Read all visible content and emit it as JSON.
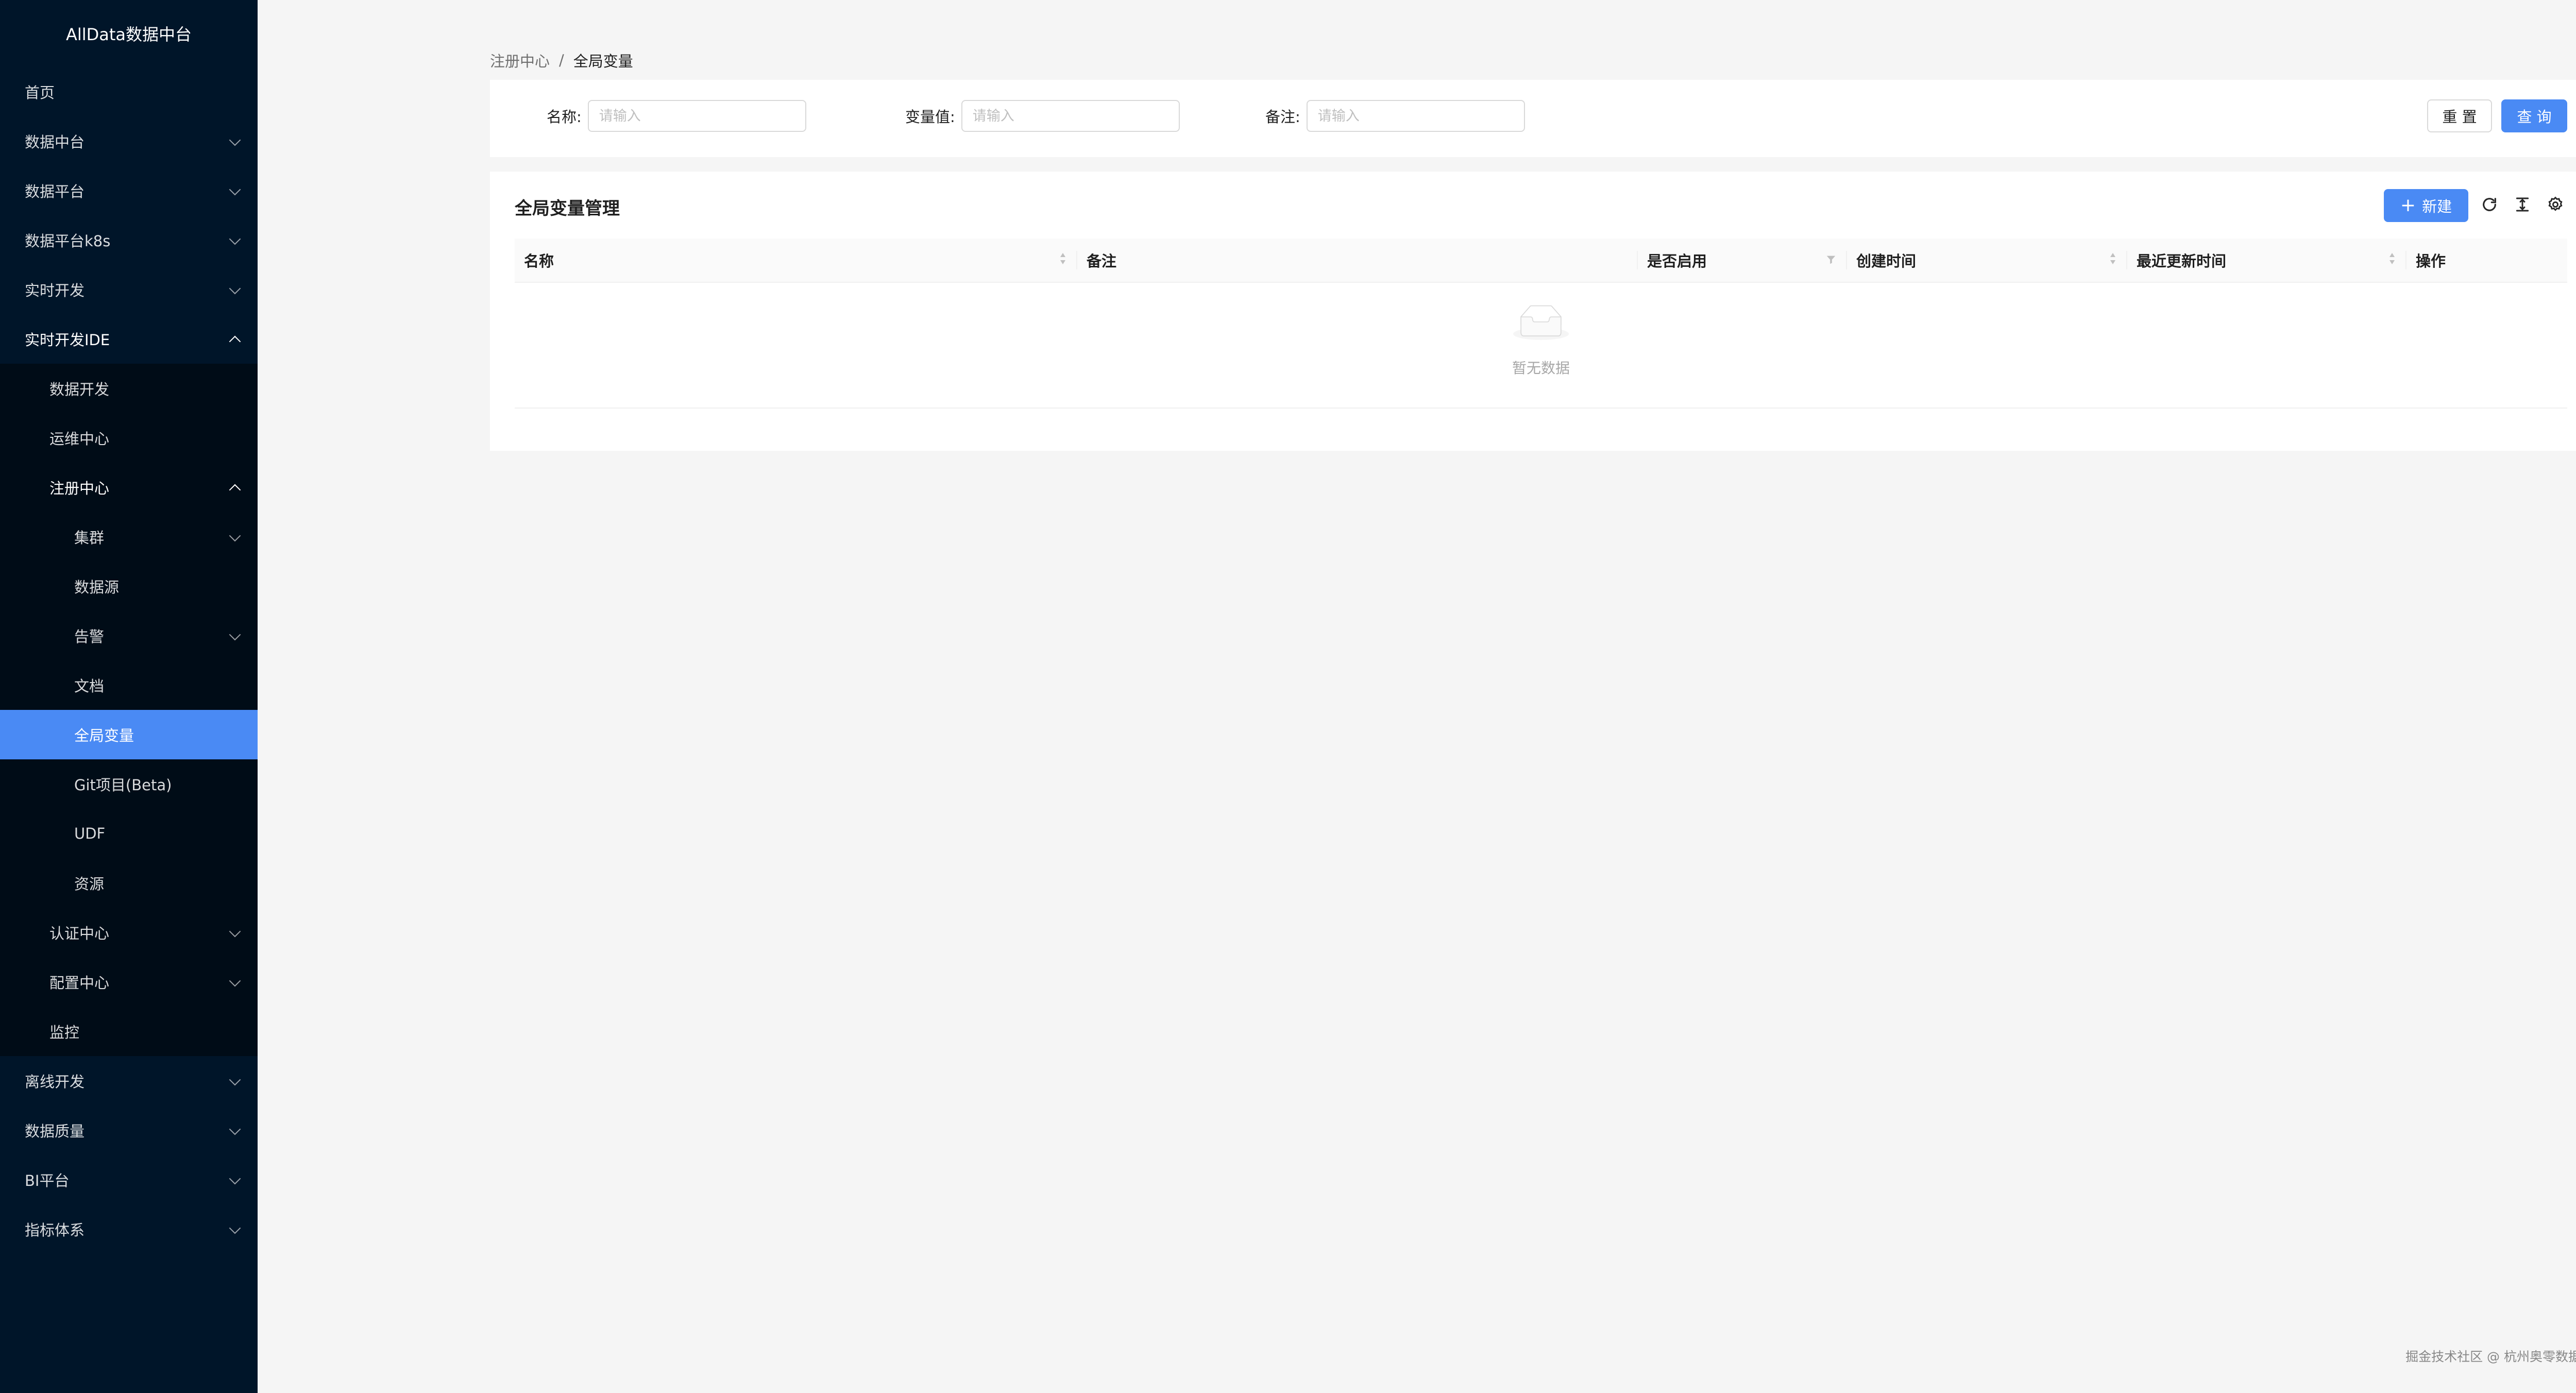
{
  "app": {
    "title": "AllData数据中台"
  },
  "sidebar": {
    "items": [
      {
        "label": "首页"
      },
      {
        "label": "数据中台"
      },
      {
        "label": "数据平台"
      },
      {
        "label": "数据平台k8s"
      },
      {
        "label": "实时开发"
      },
      {
        "label": "实时开发IDE"
      },
      {
        "label": "数据开发"
      },
      {
        "label": "运维中心"
      },
      {
        "label": "注册中心"
      },
      {
        "label": "集群"
      },
      {
        "label": "数据源"
      },
      {
        "label": "告警"
      },
      {
        "label": "文档"
      },
      {
        "label": "全局变量"
      },
      {
        "label": "Git项目(Beta)"
      },
      {
        "label": "UDF"
      },
      {
        "label": "资源"
      },
      {
        "label": "认证中心"
      },
      {
        "label": "配置中心"
      },
      {
        "label": "监控"
      },
      {
        "label": "离线开发"
      },
      {
        "label": "数据质量"
      },
      {
        "label": "BI平台"
      },
      {
        "label": "指标体系"
      }
    ]
  },
  "breadcrumb": {
    "parent": "注册中心",
    "separator": "/",
    "current": "全局变量"
  },
  "search": {
    "name_label": "名称:",
    "name_placeholder": "请输入",
    "value_label": "变量值:",
    "value_placeholder": "请输入",
    "note_label": "备注:",
    "note_placeholder": "请输入",
    "reset_label": "重 置",
    "query_label": "查 询"
  },
  "table": {
    "title": "全局变量管理",
    "new_label": "新建",
    "columns": [
      "名称",
      "备注",
      "是否启用",
      "创建时间",
      "最近更新时间",
      "操作"
    ],
    "empty_text": "暂无数据"
  },
  "footer": {
    "text": "掘金技术社区 @ 杭州奥零数据科技"
  },
  "colors": {
    "sidebar_bg": "#001529",
    "accent": "#4a8af4"
  }
}
